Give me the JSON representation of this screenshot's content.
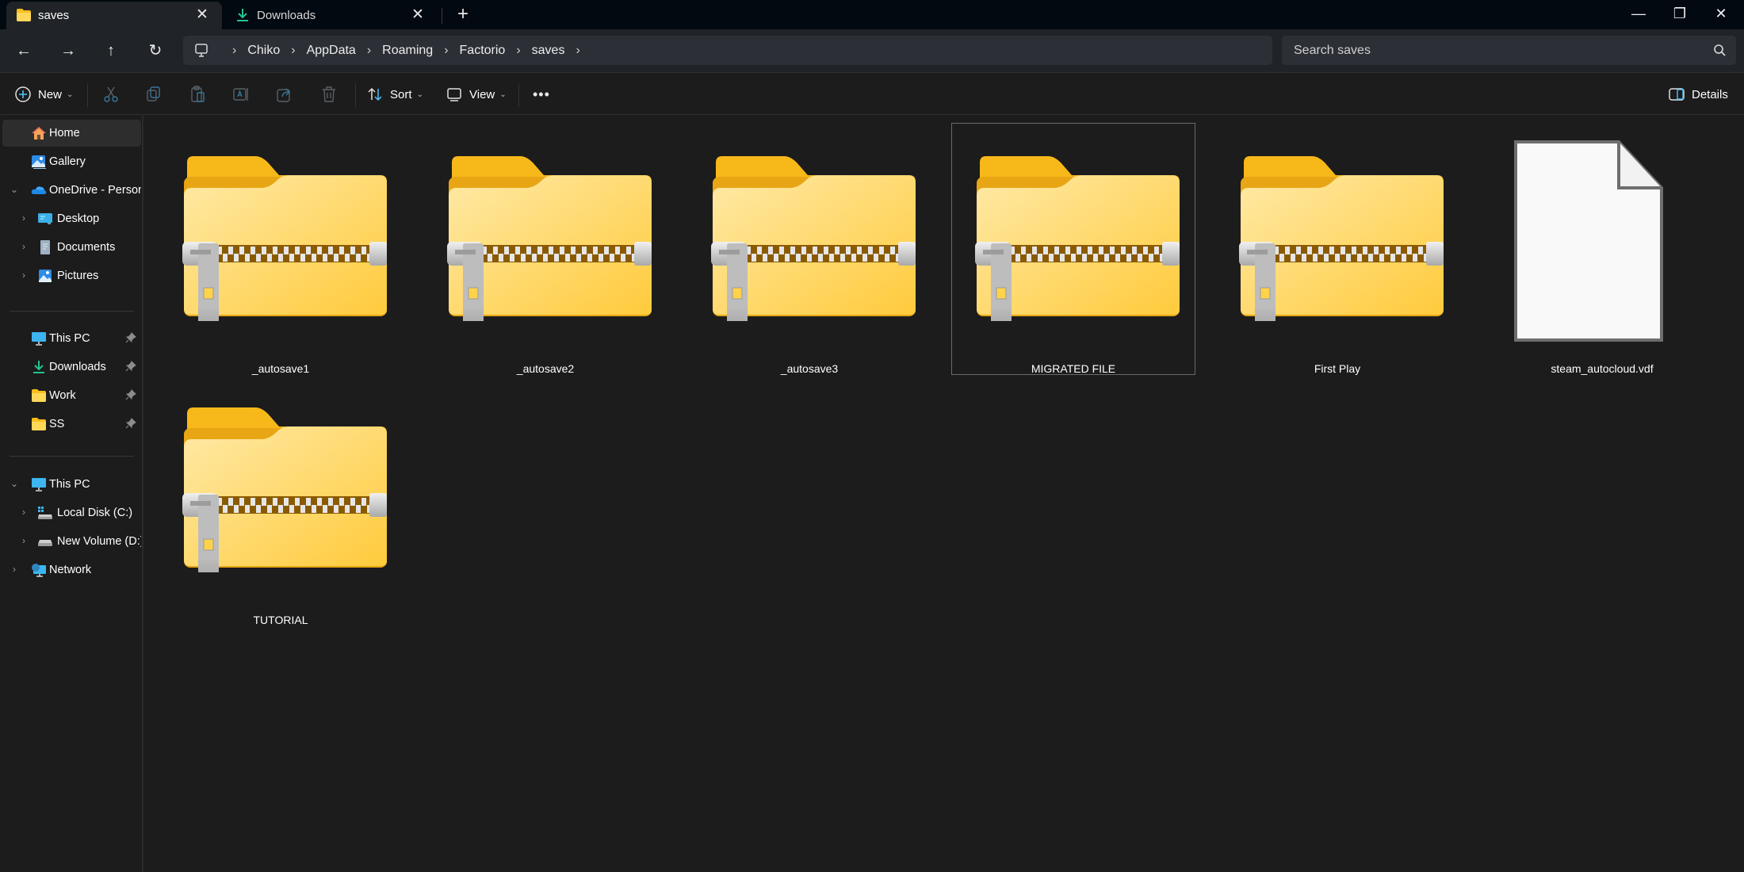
{
  "window": {
    "tabs": [
      {
        "label": "saves",
        "icon": "folder-icon",
        "active": true
      },
      {
        "label": "Downloads",
        "icon": "download-icon",
        "active": false
      }
    ],
    "new_tab_label": "+",
    "controls": {
      "minimize": "—",
      "maximize": "❐",
      "close": "✕"
    }
  },
  "navigation": {
    "back": "←",
    "forward": "→",
    "up": "↑",
    "refresh": "↻",
    "breadcrumb": [
      "Chiko",
      "AppData",
      "Roaming",
      "Factorio",
      "saves"
    ],
    "search_placeholder": "Search saves"
  },
  "commandbar": {
    "new_label": "New",
    "sort_label": "Sort",
    "view_label": "View",
    "more_label": "•••",
    "details_label": "Details",
    "disabled_actions": [
      "cut",
      "copy",
      "paste",
      "rename",
      "share",
      "delete"
    ]
  },
  "sidebar": {
    "quick": [
      {
        "label": "Home",
        "icon": "home-icon",
        "selected": true
      },
      {
        "label": "Gallery",
        "icon": "gallery-icon"
      },
      {
        "label": "OneDrive - Personal",
        "icon": "onedrive-icon",
        "expanded": true
      },
      {
        "label": "Desktop",
        "icon": "desktop-icon",
        "child": true
      },
      {
        "label": "Documents",
        "icon": "documents-icon",
        "child": true
      },
      {
        "label": "Pictures",
        "icon": "pictures-icon",
        "child": true
      }
    ],
    "pinned": [
      {
        "label": "This PC",
        "icon": "monitor-icon"
      },
      {
        "label": "Downloads",
        "icon": "download-icon"
      },
      {
        "label": "Work",
        "icon": "folder-icon"
      },
      {
        "label": "SS",
        "icon": "folder-icon"
      }
    ],
    "devices": [
      {
        "label": "This PC",
        "icon": "monitor-icon",
        "expanded": true
      },
      {
        "label": "Local Disk (C:)",
        "icon": "drive-c-icon",
        "child": true
      },
      {
        "label": "New Volume (D:)",
        "icon": "drive-icon",
        "child": true
      },
      {
        "label": "Network",
        "icon": "network-icon"
      }
    ]
  },
  "files": [
    {
      "name": "_autosave1",
      "type": "zip-folder"
    },
    {
      "name": "_autosave2",
      "type": "zip-folder"
    },
    {
      "name": "_autosave3",
      "type": "zip-folder"
    },
    {
      "name": "MIGRATED FILE",
      "type": "zip-folder",
      "focused": true
    },
    {
      "name": "First Play",
      "type": "zip-folder"
    },
    {
      "name": "steam_autocloud.vdf",
      "type": "generic-file"
    },
    {
      "name": "TUTORIAL",
      "type": "zip-folder"
    }
  ],
  "colors": {
    "folder_light": "#FFE38A",
    "folder_dark": "#F9BE1E",
    "accent_blue": "#4CC2FF",
    "download_green": "#23C48E"
  }
}
